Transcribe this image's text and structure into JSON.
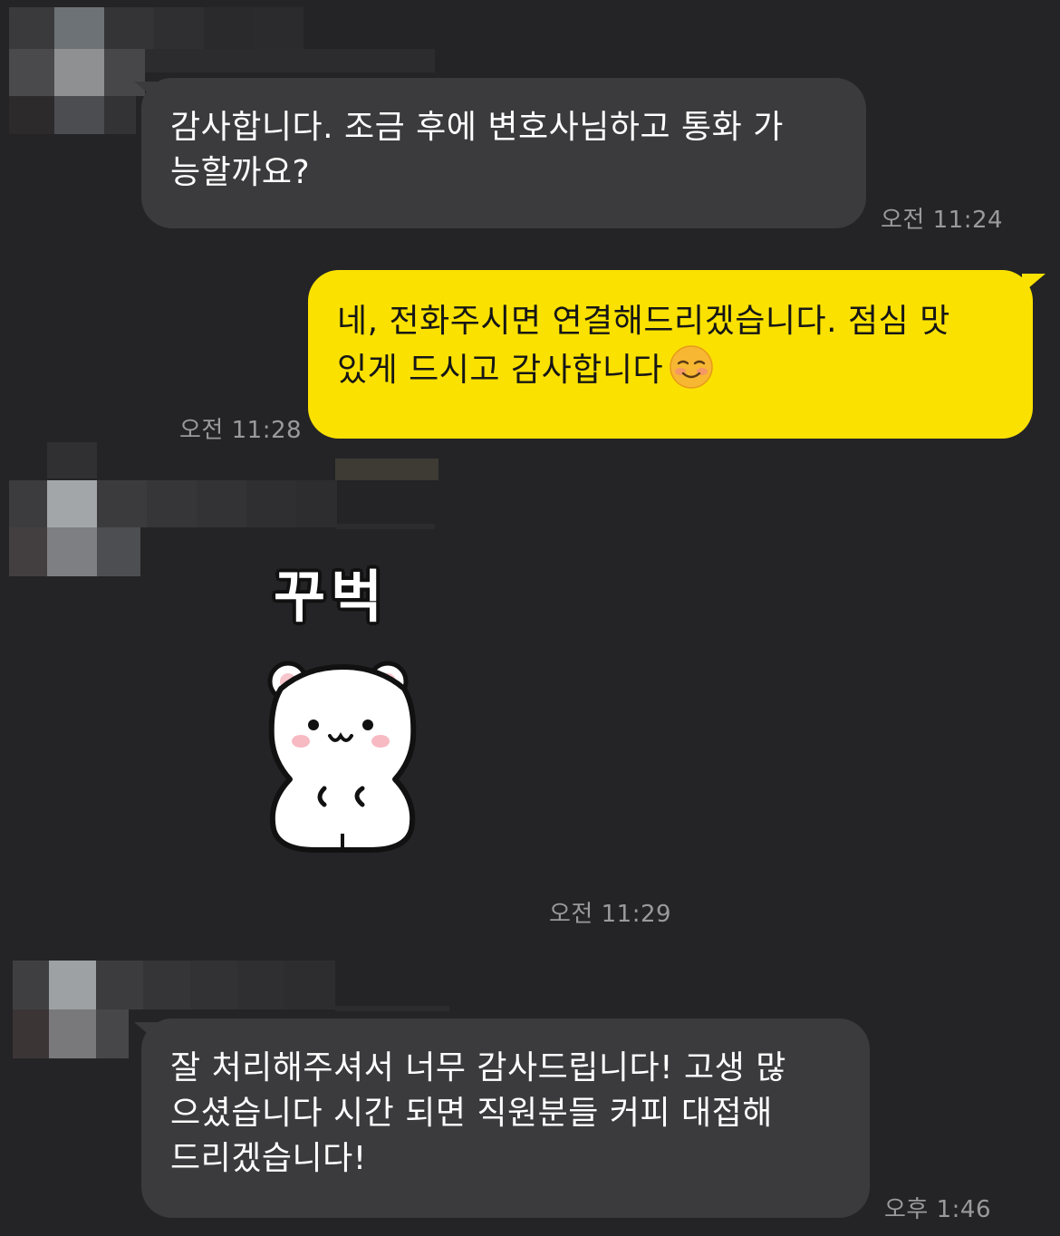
{
  "conversation": {
    "messages": [
      {
        "sender": "other",
        "lines": [
          "감사합니다. 조금 후에 변호사님하고 통화 가",
          "능할까요?"
        ],
        "time": "오전 11:24"
      },
      {
        "sender": "me",
        "lines": [
          "네, 전화주시면 연결해드리겠습니다. 점심 맛",
          "있게 드시고 감사합니다"
        ],
        "emoji": "smiling-face-emoji",
        "time": "오전 11:28"
      },
      {
        "sender": "other",
        "type": "sticker",
        "sticker_text": "꾸벅",
        "sticker_icon": "bowing-bear-sticker",
        "time": "오전 11:29"
      },
      {
        "sender": "other",
        "lines": [
          "잘 처리해주셔서 너무 감사드립니다! 고생 많",
          "으셨습니다 시간 되면 직원분들 커피 대접해",
          "드리겠습니다!"
        ],
        "time": "오후 1:46"
      }
    ]
  },
  "colors": {
    "background": "#242426",
    "incoming_bubble": "#3b3b3d",
    "outgoing_bubble": "#fae100",
    "timestamp": "#9a9a9c"
  }
}
